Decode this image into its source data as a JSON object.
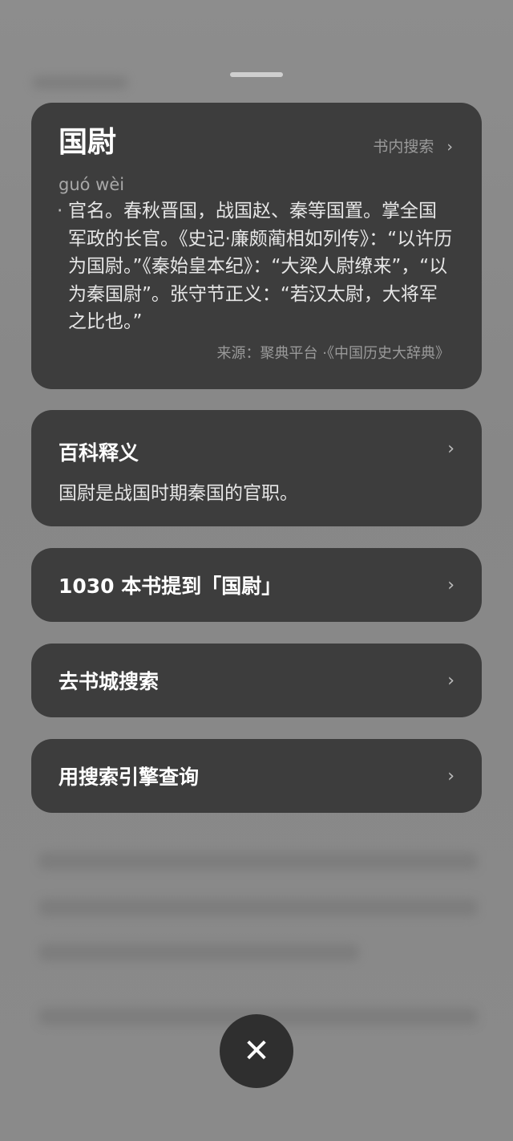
{
  "definition": {
    "word": "国尉",
    "in_book_search": "书内搜索",
    "pinyin": "guó wèi",
    "text": "官名。春秋晋国，战国赵、秦等国置。掌全国军政的长官。《史记·廉颇蔺相如列传》：“以许历为国尉。”《秦始皇本纪》：“大梁人尉缭来”，“以为秦国尉”。张守节正义：“若汉太尉，大将军之比也。”",
    "source": "来源：聚典平台 ·《中国历史大辞典》"
  },
  "baike": {
    "title": "百科释义",
    "desc": "国尉是战国时期秦国的官职。"
  },
  "actions": [
    {
      "label": "1030 本书提到「国尉」"
    },
    {
      "label": "去书城搜索"
    },
    {
      "label": "用搜索引擎查询"
    }
  ],
  "icons": {
    "chevron": "chevron-right-icon",
    "close": "close-icon"
  }
}
